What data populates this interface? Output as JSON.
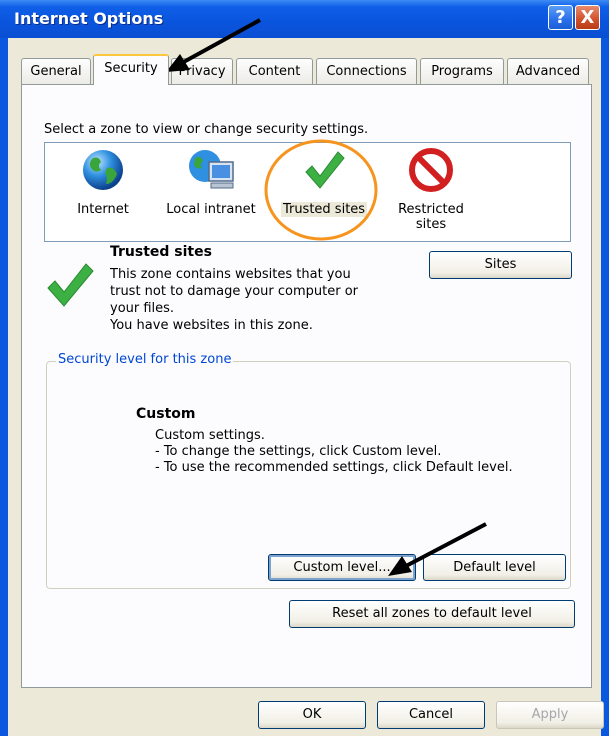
{
  "window": {
    "title": "Internet Options"
  },
  "titlebar_buttons": {
    "help": "?",
    "close": "X"
  },
  "tabs": [
    {
      "label": "General"
    },
    {
      "label": "Security"
    },
    {
      "label": "Privacy"
    },
    {
      "label": "Content"
    },
    {
      "label": "Connections"
    },
    {
      "label": "Programs"
    },
    {
      "label": "Advanced"
    }
  ],
  "active_tab": "Security",
  "zone_prompt": "Select a zone to view or change security settings.",
  "zones": [
    {
      "label": "Internet",
      "icon": "globe-icon"
    },
    {
      "label": "Local intranet",
      "icon": "intranet-icon"
    },
    {
      "label": "Trusted sites",
      "icon": "checkmark-icon"
    },
    {
      "label": "Restricted",
      "label2": "sites",
      "icon": "no-entry-icon"
    }
  ],
  "selected_zone": "Trusted sites",
  "zone_info": {
    "title": "Trusted sites",
    "lines": [
      "This zone contains websites that you",
      "trust not to damage your computer or",
      "your files.",
      "You have websites in this zone."
    ],
    "sites_button": "Sites"
  },
  "security_level": {
    "legend": "Security level for this zone",
    "level_title": "Custom",
    "lines": [
      "Custom settings.",
      "- To change the settings, click Custom level.",
      "- To use the recommended settings, click Default level."
    ],
    "custom_button": "Custom level...",
    "default_button": "Default level"
  },
  "reset_button": "Reset all zones to default level",
  "footer": {
    "ok": "OK",
    "cancel": "Cancel",
    "apply": "Apply"
  },
  "colors": {
    "title_bar": "#0a54dc",
    "highlight_circle": "#f7941d",
    "legend_text": "#0046d5",
    "checkmark": "#3cb043"
  }
}
